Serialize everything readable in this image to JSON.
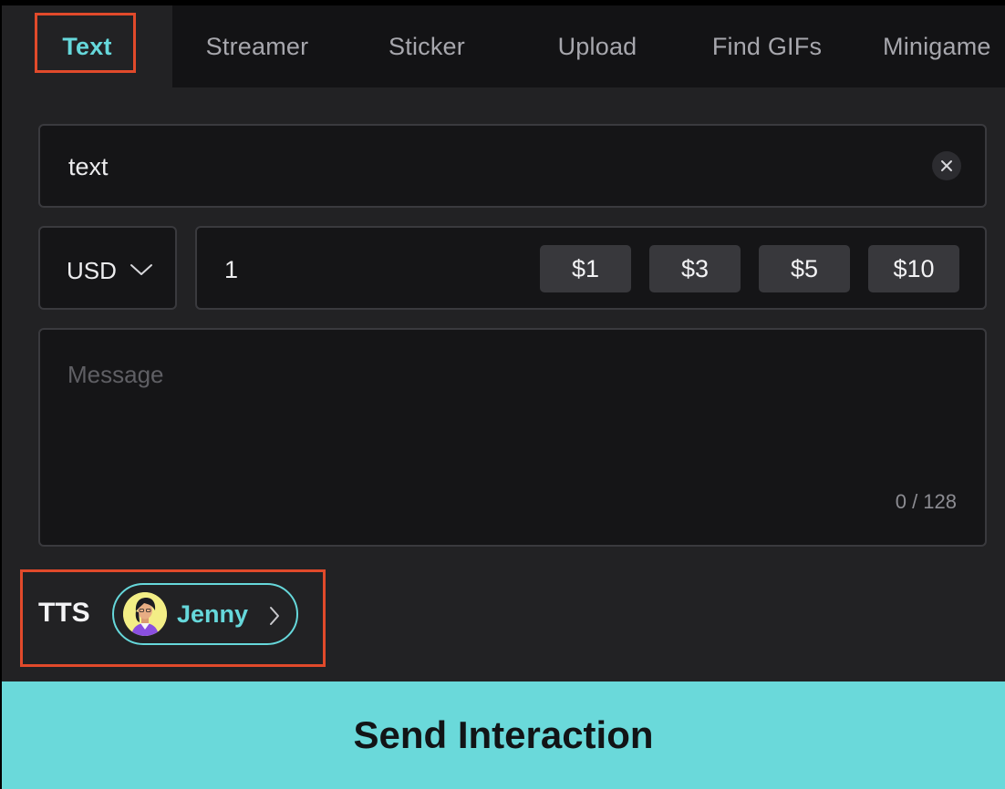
{
  "tabs": [
    {
      "label": "Text",
      "active": true
    },
    {
      "label": "Streamer",
      "active": false
    },
    {
      "label": "Sticker",
      "active": false
    },
    {
      "label": "Upload",
      "active": false
    },
    {
      "label": "Find GIFs",
      "active": false
    },
    {
      "label": "Minigame",
      "active": false
    }
  ],
  "form": {
    "text_value": "text",
    "currency": "USD",
    "amount": "1",
    "presets": [
      "$1",
      "$3",
      "$5",
      "$10"
    ],
    "message_placeholder": "Message",
    "message_value": "",
    "char_counter": "0 / 128"
  },
  "tts": {
    "label": "TTS",
    "voice": "Jenny"
  },
  "send_button": "Send Interaction",
  "colors": {
    "accent": "#66d8db",
    "highlight_border": "#e14a2b",
    "background": "#222224",
    "tab_bar": "#131315",
    "send_button": "#6ad9da"
  },
  "icons": {
    "clear": "close-icon",
    "currency_dropdown": "chevron-down-icon",
    "voice_chevron": "chevron-right-icon",
    "voice_avatar": "avatar"
  }
}
